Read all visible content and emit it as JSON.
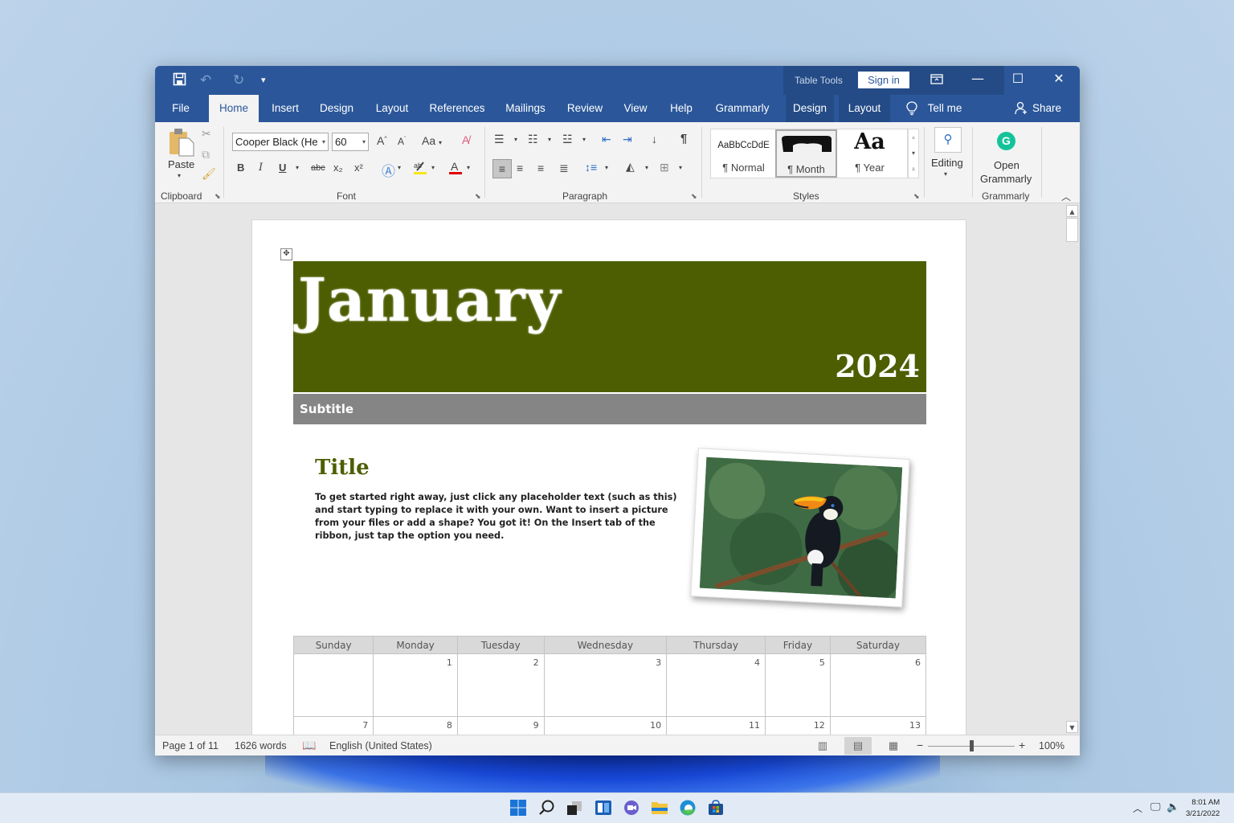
{
  "app": {
    "quick_access": {
      "save_icon": "save-icon",
      "undo_icon": "undo-icon",
      "redo_icon": "redo-icon",
      "customize_icon": "customize-qat-icon"
    },
    "contextual_tab_group": "Table Tools",
    "sign_in_label": "Sign in",
    "window_controls": {
      "ribbon_display_icon": "ribbon-display-options-icon",
      "minimize": "—",
      "maximize": "☐",
      "close": "✕"
    }
  },
  "tabs": [
    {
      "label": "File",
      "active": false
    },
    {
      "label": "Home",
      "active": true
    },
    {
      "label": "Insert",
      "active": false
    },
    {
      "label": "Design",
      "active": false
    },
    {
      "label": "Layout",
      "active": false
    },
    {
      "label": "References",
      "active": false
    },
    {
      "label": "Mailings",
      "active": false
    },
    {
      "label": "Review",
      "active": false
    },
    {
      "label": "View",
      "active": false
    },
    {
      "label": "Help",
      "active": false
    },
    {
      "label": "Grammarly",
      "active": false
    },
    {
      "label": "Design",
      "active": false,
      "contextual": true
    },
    {
      "label": "Layout",
      "active": false,
      "contextual": true
    }
  ],
  "tell_me_label": "Tell me",
  "share_label": "Share",
  "ribbon": {
    "clipboard": {
      "label": "Clipboard",
      "paste_label": "Paste"
    },
    "font": {
      "label": "Font",
      "font_name": "Cooper Black (He",
      "font_size": "60",
      "bold": "B",
      "italic": "I",
      "underline": "U",
      "strikethrough": "abc",
      "subscript": "x₂",
      "superscript": "x²",
      "change_case": "Aa"
    },
    "paragraph": {
      "label": "Paragraph",
      "show_marks": "¶"
    },
    "styles": {
      "label": "Styles",
      "items": [
        {
          "preview": "AaBbCcDdE",
          "name": "¶ Normal",
          "selected": false
        },
        {
          "preview": "▀▀",
          "name": "¶ Month",
          "selected": true
        },
        {
          "preview": "Aa",
          "name": "¶ Year",
          "selected": false
        }
      ]
    },
    "editing": {
      "label": "Editing"
    },
    "grammarly": {
      "label": "Grammarly",
      "open_line1": "Open",
      "open_line2": "Grammarly",
      "brand_color": "#15c39a"
    }
  },
  "document": {
    "month": "January",
    "year": "2024",
    "subtitle": "Subtitle",
    "title": "Title",
    "body": "To get started right away, just click any placeholder text (such as this) and start typing to replace it with your own. Want to insert a picture from your files or add a shape? You got it! On the Insert tab of the ribbon, just tap the option you need.",
    "banner_color": "#4d5e02",
    "subtitle_bar_color": "#858585",
    "photo_alt": "Toucan on a branch",
    "calendar": {
      "headers": [
        "Sunday",
        "Monday",
        "Tuesday",
        "Wednesday",
        "Thursday",
        "Friday",
        "Saturday"
      ],
      "weeks": [
        [
          "",
          "1",
          "2",
          "3",
          "4",
          "5",
          "6"
        ],
        [
          "7",
          "8",
          "9",
          "10",
          "11",
          "12",
          "13"
        ]
      ]
    }
  },
  "status": {
    "page": "Page 1 of 11",
    "words": "1626 words",
    "language": "English (United States)",
    "zoom_minus": "−",
    "zoom_plus": "+",
    "zoom": "100%"
  },
  "taskbar": {
    "icons": [
      "start-icon",
      "search-icon",
      "task-view-icon",
      "widgets-icon",
      "teams-chat-icon",
      "file-explorer-icon",
      "edge-icon",
      "store-icon"
    ],
    "time": "8:01 AM",
    "date": "3/21/2022"
  }
}
